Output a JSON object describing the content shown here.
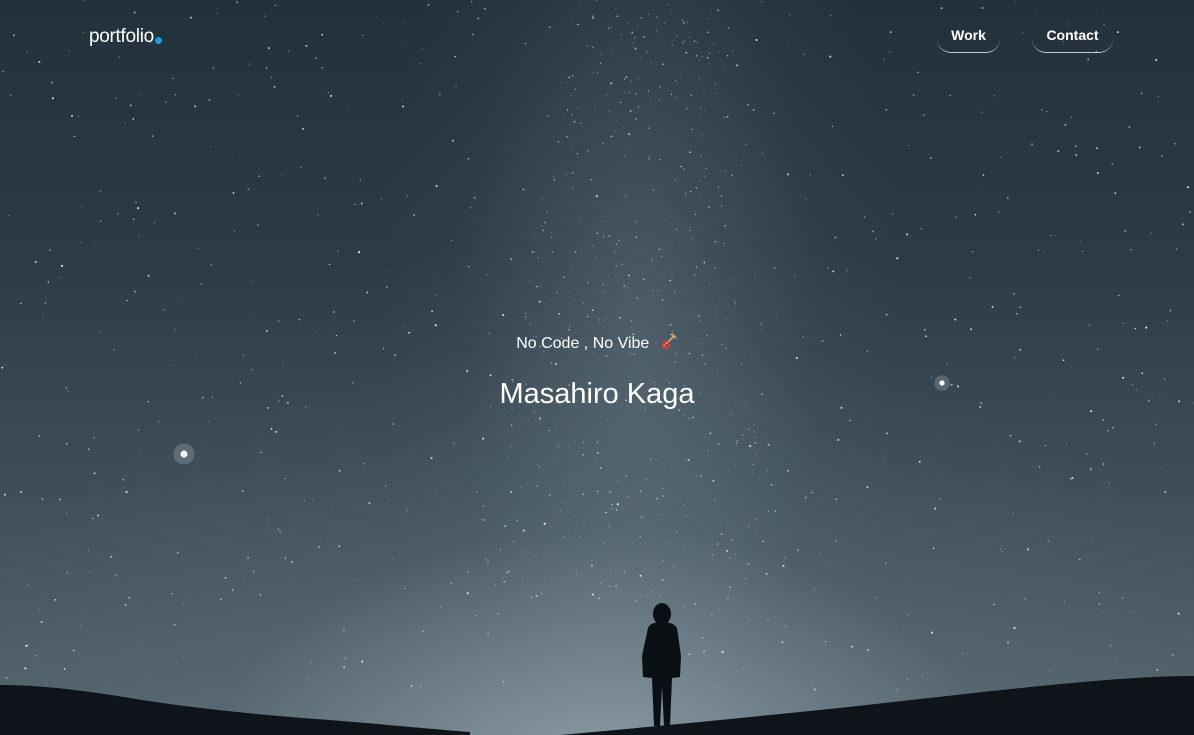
{
  "nav": {
    "logo_text": "portfolio",
    "logo_dot_color": "#1e9be6",
    "links": [
      {
        "label": "Work"
      },
      {
        "label": "Contact"
      }
    ]
  },
  "hero": {
    "tagline": "No Code , No Vibe",
    "tagline_icon": "guitar-icon",
    "name": "Masahiro Kaga"
  }
}
